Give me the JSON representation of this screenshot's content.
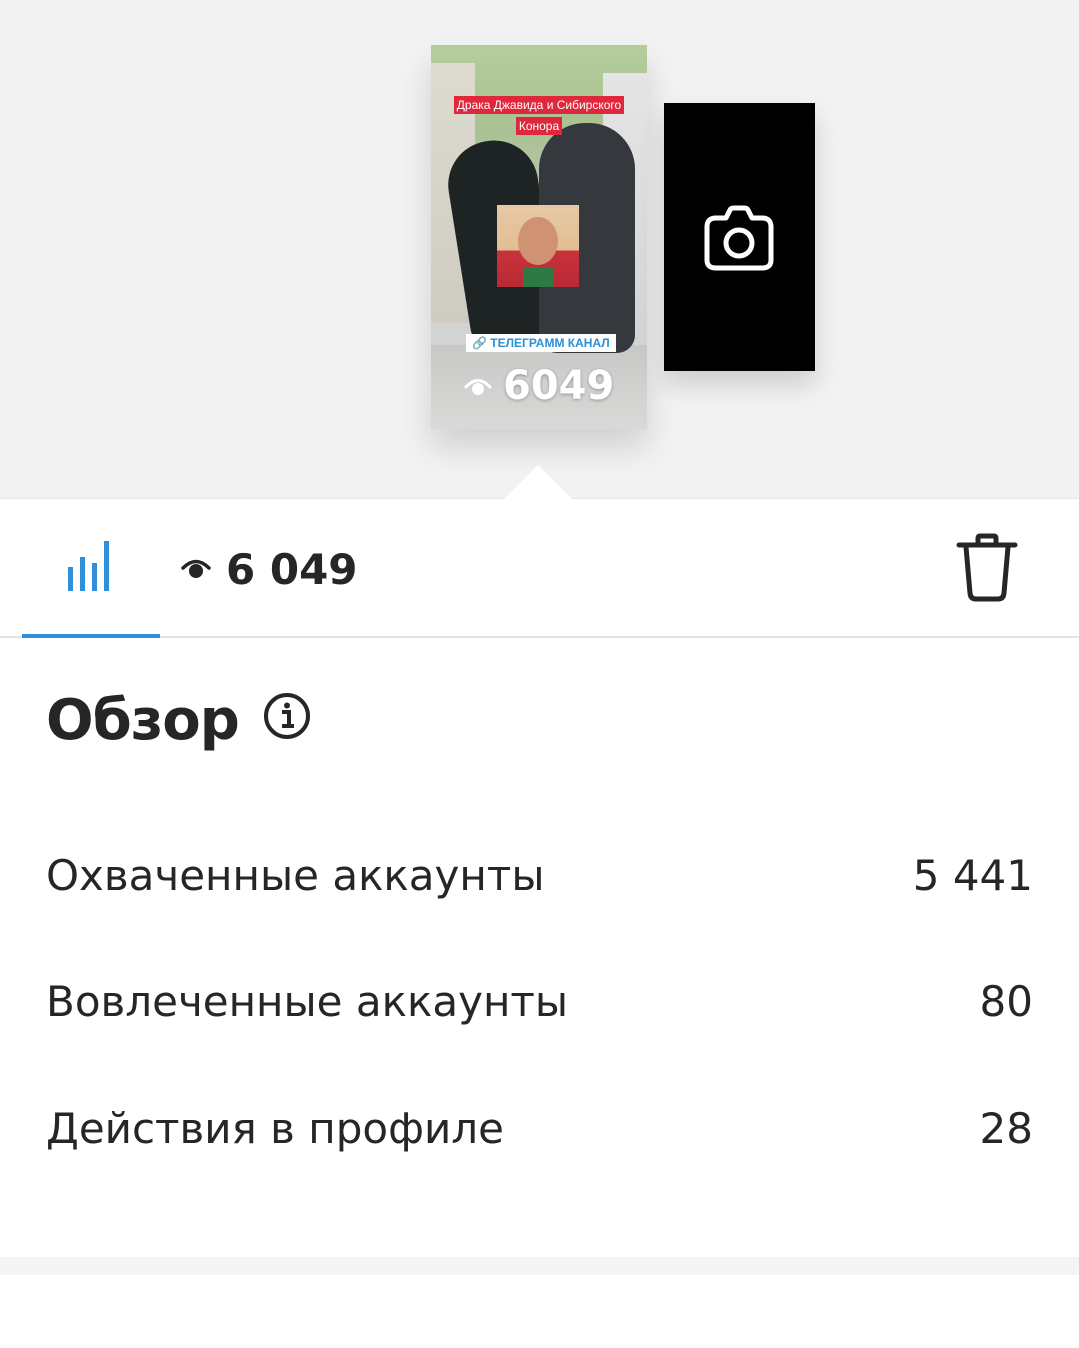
{
  "story": {
    "title_line1": "Драка Джавида и Сибирского",
    "title_line2": "Конора",
    "badge_text": "ТЕЛЕГРАММ КАНАЛ",
    "overlay_views": "6049"
  },
  "tabs": {
    "views_count": "6 049"
  },
  "overview": {
    "title": "Обзор",
    "metrics": [
      {
        "label": "Охваченные аккаунты",
        "value": "5 441"
      },
      {
        "label": "Вовлеченные аккаунты",
        "value": "80"
      },
      {
        "label": "Действия в профиле",
        "value": "28"
      }
    ]
  },
  "colors": {
    "accent": "#2f8fd8",
    "text": "#262626",
    "title_banner": "#e0273b"
  },
  "icons": [
    "camera-icon",
    "bar-chart-icon",
    "eye-icon",
    "trash-icon",
    "info-icon",
    "link-icon"
  ]
}
